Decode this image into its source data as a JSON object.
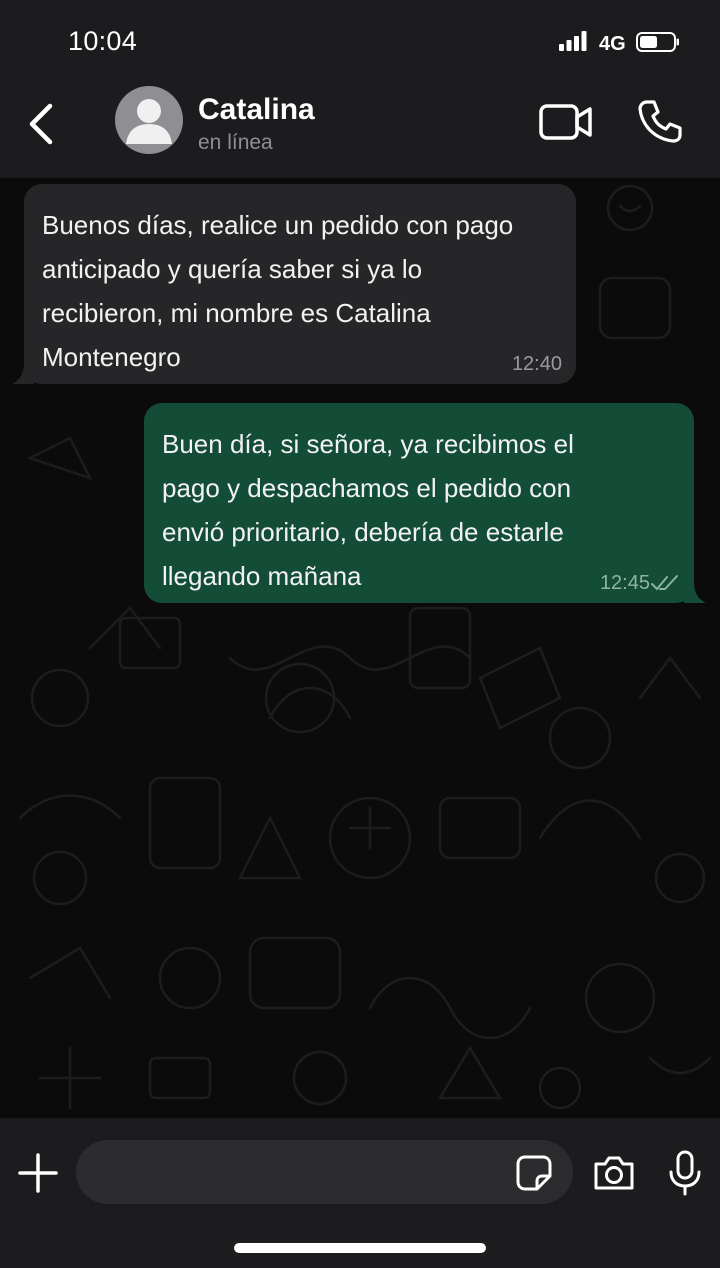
{
  "status_bar": {
    "time": "10:04",
    "network": "4G",
    "icons": [
      "signal-icon",
      "battery-icon"
    ]
  },
  "header": {
    "contact_name": "Catalina",
    "contact_status": "en línea",
    "icons": [
      "back-arrow-icon",
      "avatar-placeholder-icon",
      "video-camera-icon",
      "phone-icon"
    ]
  },
  "messages": [
    {
      "direction": "incoming",
      "lines": [
        "Buenos días, realice un pedido con pago",
        "anticipado y quería saber si ya lo",
        "recibieron, mi nombre es Catalina",
        "Montenegro"
      ],
      "time": "12:40"
    },
    {
      "direction": "outgoing",
      "lines": [
        "Buen día, si señora, ya recibimos el",
        "pago y despachamos el pedido con",
        "envió prioritario, debería de estarle",
        "llegando mañana"
      ],
      "time": "12:45",
      "status_icon": "double-check-icon"
    }
  ],
  "composer": {
    "input_value": "",
    "icons": [
      "plus-icon",
      "sticker-icon",
      "camera-icon",
      "microphone-icon"
    ]
  },
  "colors": {
    "bar_background": "#1c1c1e",
    "chat_background": "#0b0b0b",
    "incoming_bubble": "#262628",
    "outgoing_bubble": "#144d37",
    "secondary_text": "#8e8e93"
  }
}
